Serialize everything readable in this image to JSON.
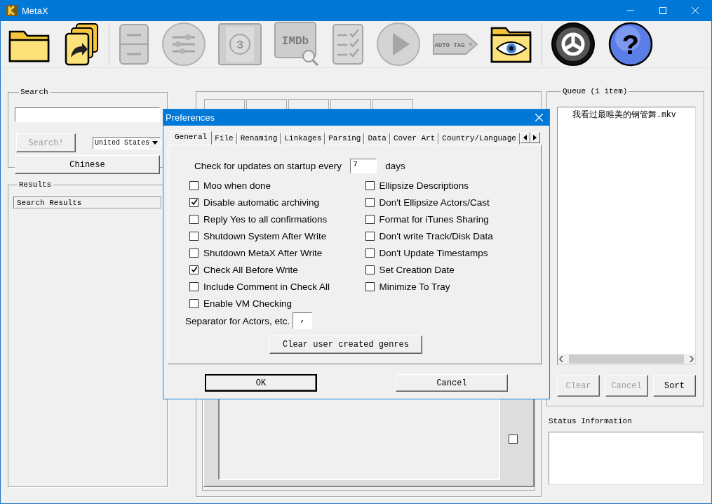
{
  "window": {
    "title": "MetaX"
  },
  "toolbar": [
    [
      {
        "kind": "open-folder",
        "disabled": false
      },
      {
        "kind": "redo-docs",
        "disabled": false
      }
    ],
    [
      {
        "kind": "cabinet",
        "disabled": true
      },
      {
        "kind": "sliders",
        "disabled": true
      },
      {
        "kind": "film",
        "disabled": true,
        "label": "3"
      },
      {
        "kind": "imdb",
        "disabled": true,
        "label": "IMDb"
      },
      {
        "kind": "checklist",
        "disabled": true
      },
      {
        "kind": "play",
        "disabled": true
      },
      {
        "kind": "tag",
        "disabled": true,
        "label": "AUTO TAG"
      },
      {
        "kind": "eye-folder",
        "disabled": false
      }
    ],
    [
      {
        "kind": "gear",
        "disabled": false
      },
      {
        "kind": "help",
        "disabled": false,
        "label": "?"
      }
    ]
  ],
  "search": {
    "title": "Search",
    "button": {
      "label": "Search!",
      "disabled": true
    },
    "country": "United States",
    "language_button": "Chinese"
  },
  "results": {
    "title": "Results",
    "column": "Search Results"
  },
  "editor": {
    "checkbox": {
      "checked": false
    }
  },
  "queue": {
    "title": "Queue (1 item)",
    "items": [
      {
        "name": "我看过最唯美的钢管舞.mkv",
        "selected": false
      }
    ],
    "buttons": [
      {
        "label": "Clear",
        "disabled": true
      },
      {
        "label": "Cancel",
        "disabled": true
      },
      {
        "label": "Sort",
        "disabled": false
      }
    ]
  },
  "status": {
    "title": "Status Information"
  },
  "preferences": {
    "title": "Preferences",
    "tabs": [
      {
        "label": "General",
        "selected": true
      },
      {
        "label": "File",
        "selected": false
      },
      {
        "label": "Renaming",
        "selected": false
      },
      {
        "label": "Linkages",
        "selected": false
      },
      {
        "label": "Parsing",
        "selected": false
      },
      {
        "label": "Data",
        "selected": false
      },
      {
        "label": "Cover Art",
        "selected": false
      },
      {
        "label": "Country/Language",
        "selected": false
      }
    ],
    "update_check": {
      "before": "Check for updates on startup every",
      "value": "7",
      "after": "days"
    },
    "options_left": [
      {
        "label": "Moo when done",
        "checked": false
      },
      {
        "label": "Disable automatic archiving",
        "checked": true
      },
      {
        "label": "Reply Yes to all confirmations",
        "checked": false
      },
      {
        "label": "Shutdown System After Write",
        "checked": false
      },
      {
        "label": "Shutdown MetaX After Write",
        "checked": false
      },
      {
        "label": "Check All Before Write",
        "checked": true
      },
      {
        "label": "Include Comment in Check All",
        "checked": false
      },
      {
        "label": "Enable VM Checking",
        "checked": false
      }
    ],
    "options_right": [
      {
        "label": "Ellipsize Descriptions",
        "checked": false
      },
      {
        "label": "Don't Ellipsize Actors/Cast",
        "checked": false
      },
      {
        "label": "Format for iTunes Sharing",
        "checked": false
      },
      {
        "label": "Don't write Track/Disk Data",
        "checked": false
      },
      {
        "label": "Don't Update Timestamps",
        "checked": false
      },
      {
        "label": "Set Creation Date",
        "checked": false
      },
      {
        "label": "Minimize To Tray",
        "checked": false
      }
    ],
    "separator": {
      "label": "Separator for Actors, etc.",
      "value": ","
    },
    "clear_button": "Clear user created genres",
    "buttons": [
      {
        "label": "OK",
        "default": true
      },
      {
        "label": "Cancel",
        "default": false
      }
    ]
  }
}
